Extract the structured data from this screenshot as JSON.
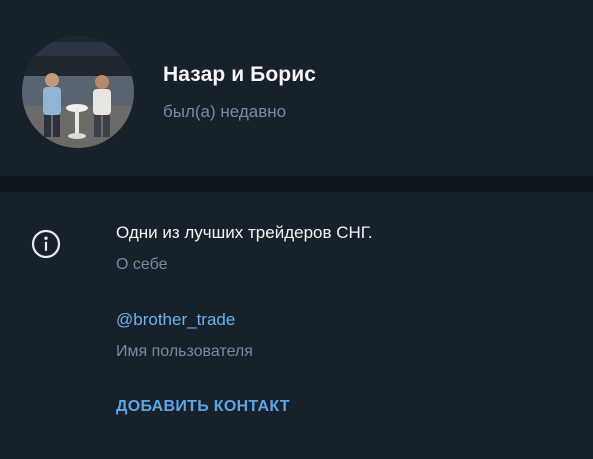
{
  "profile": {
    "name": "Назар и Борис",
    "status": "был(а) недавно",
    "avatar": "profile-photo"
  },
  "info": {
    "icon": "info-icon",
    "bio": "Одни из лучших трейдеров СНГ.",
    "bio_label": "О себе",
    "username": "@brother_trade",
    "username_label": "Имя пользователя",
    "add_contact_label": "ДОБАВИТЬ КОНТАКТ"
  },
  "colors": {
    "background": "#17212b",
    "divider": "#0f161e",
    "primary_text": "#f5f5f5",
    "secondary_text": "#7c8a99",
    "link": "#6fb1e8"
  }
}
